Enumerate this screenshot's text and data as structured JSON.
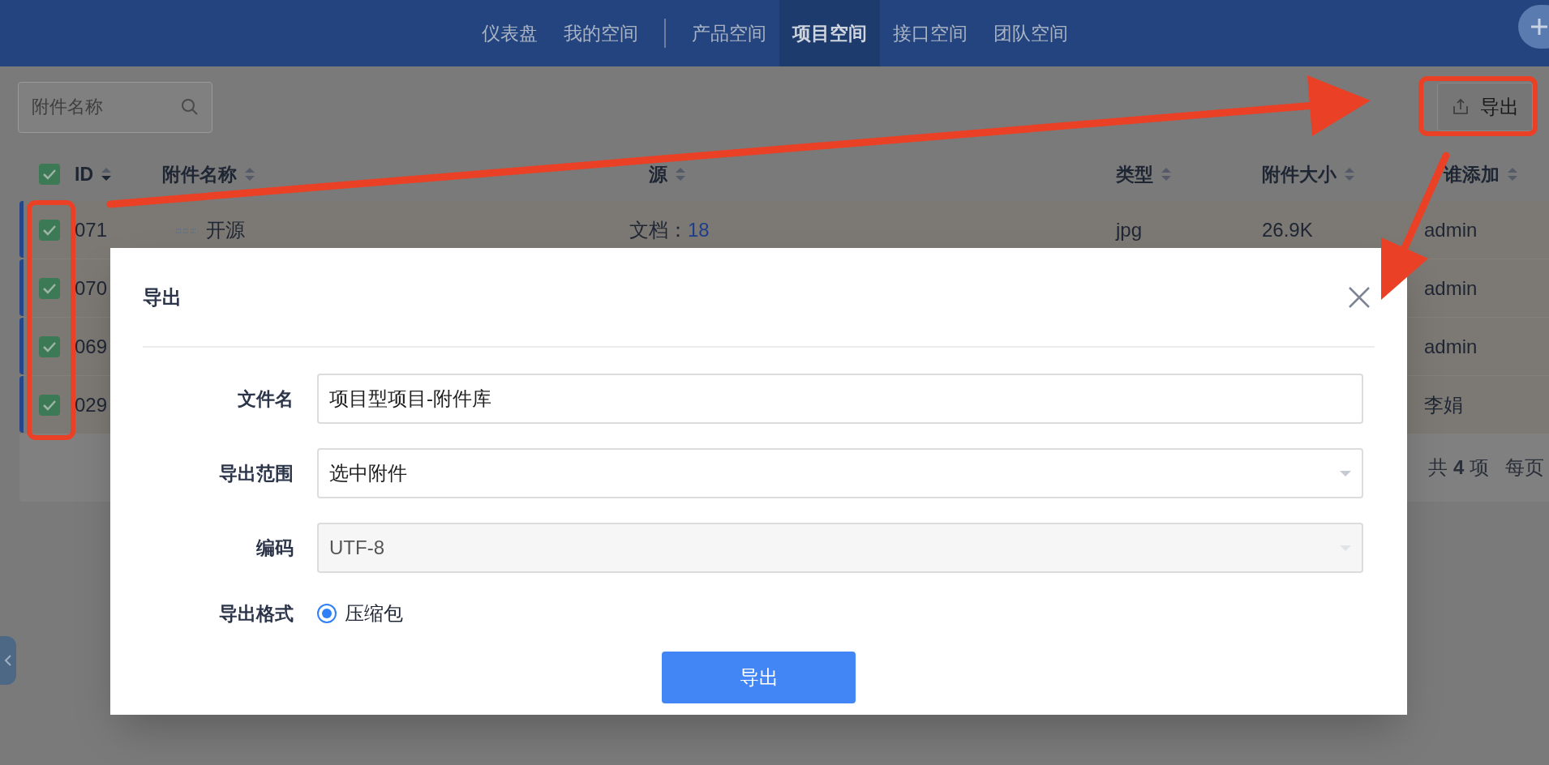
{
  "nav": {
    "groups": [
      [
        {
          "label": "仪表盘",
          "selected": false
        },
        {
          "label": "我的空间",
          "selected": false
        }
      ],
      [
        {
          "label": "产品空间",
          "selected": false
        },
        {
          "label": "项目空间",
          "selected": true
        },
        {
          "label": "接口空间",
          "selected": false
        },
        {
          "label": "团队空间",
          "selected": false
        }
      ]
    ]
  },
  "toolbar": {
    "search": {
      "placeholder": "附件名称"
    },
    "export_button": "导出"
  },
  "table": {
    "all_checked": true,
    "columns": [
      {
        "label": "ID",
        "sorted": true
      },
      {
        "label": "附件名称",
        "sorted": false
      },
      {
        "label": "源",
        "sorted": false
      },
      {
        "label": "类型",
        "sorted": false
      },
      {
        "label": "附件大小",
        "sorted": false
      },
      {
        "label": "谁添加",
        "sorted": false
      }
    ],
    "rows": [
      {
        "checked": true,
        "id": "071",
        "name": "开源",
        "source_label": "文档：",
        "source_link": "18",
        "type": "jpg",
        "size": "26.9K",
        "added_by": "admin"
      },
      {
        "checked": true,
        "id": "070",
        "added_by": "admin"
      },
      {
        "checked": true,
        "id": "069",
        "added_by": "admin"
      },
      {
        "checked": true,
        "id": "029",
        "added_by": "李娟"
      }
    ],
    "summary": "共 **4** 项",
    "per_page_label": "每页"
  },
  "dialog": {
    "title": "导出",
    "fields": [
      {
        "kind": "text",
        "label": "文件名",
        "value": "项目型项目-附件库",
        "disabled": false
      },
      {
        "kind": "select",
        "label": "导出范围",
        "value": "选中附件",
        "disabled": false
      },
      {
        "kind": "select",
        "label": "编码",
        "value": "UTF-8",
        "disabled": true
      },
      {
        "kind": "radio",
        "label": "导出格式",
        "options": [
          {
            "label": "压缩包",
            "selected": true
          }
        ]
      }
    ],
    "submit": "导出"
  }
}
